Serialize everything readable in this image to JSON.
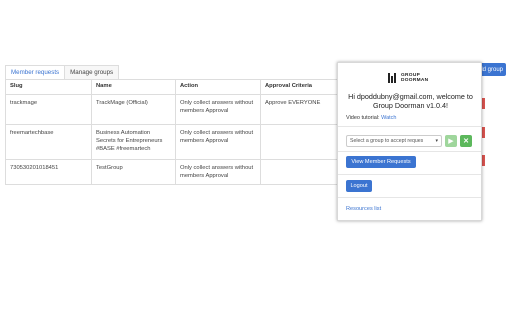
{
  "tabs": [
    {
      "label": "Member requests"
    },
    {
      "label": "Manage groups"
    }
  ],
  "add_group_label": "dd group",
  "table": {
    "headers": {
      "slug": "Slug",
      "name": "Name",
      "action": "Action",
      "criteria": "Approval Criteria"
    },
    "rows": [
      {
        "slug": "trackmage",
        "name": "TrackMage (Official)",
        "action": "Only collect answers without members Approval",
        "criteria": "Approve EVERYONE"
      },
      {
        "slug": "freemartechbase",
        "name": "Business Automation Secrets for Entrepreneurs #BASE #freemartech",
        "action": "Only collect answers without members Approval",
        "criteria": ""
      },
      {
        "slug": "730530201018451",
        "name": "TestGroup",
        "action": "Only collect answers without members Approval",
        "criteria": ""
      }
    ]
  },
  "popup": {
    "logo_line1": "GROUP",
    "logo_line2": "DOORMAN",
    "greeting": "Hi dpoddubny@gmail.com, welcome to Group Doorman v1.0.4!",
    "video_label": "Video tutorial:",
    "video_link": "Watch",
    "select_placeholder": "Select a group to accept reques",
    "view_requests_label": "View Member Requests",
    "logout_label": "Logout",
    "resources_label": "Resources list"
  },
  "colors": {
    "accent": "#3b74d1",
    "success": "#5cb85c",
    "danger": "#d9534f"
  }
}
